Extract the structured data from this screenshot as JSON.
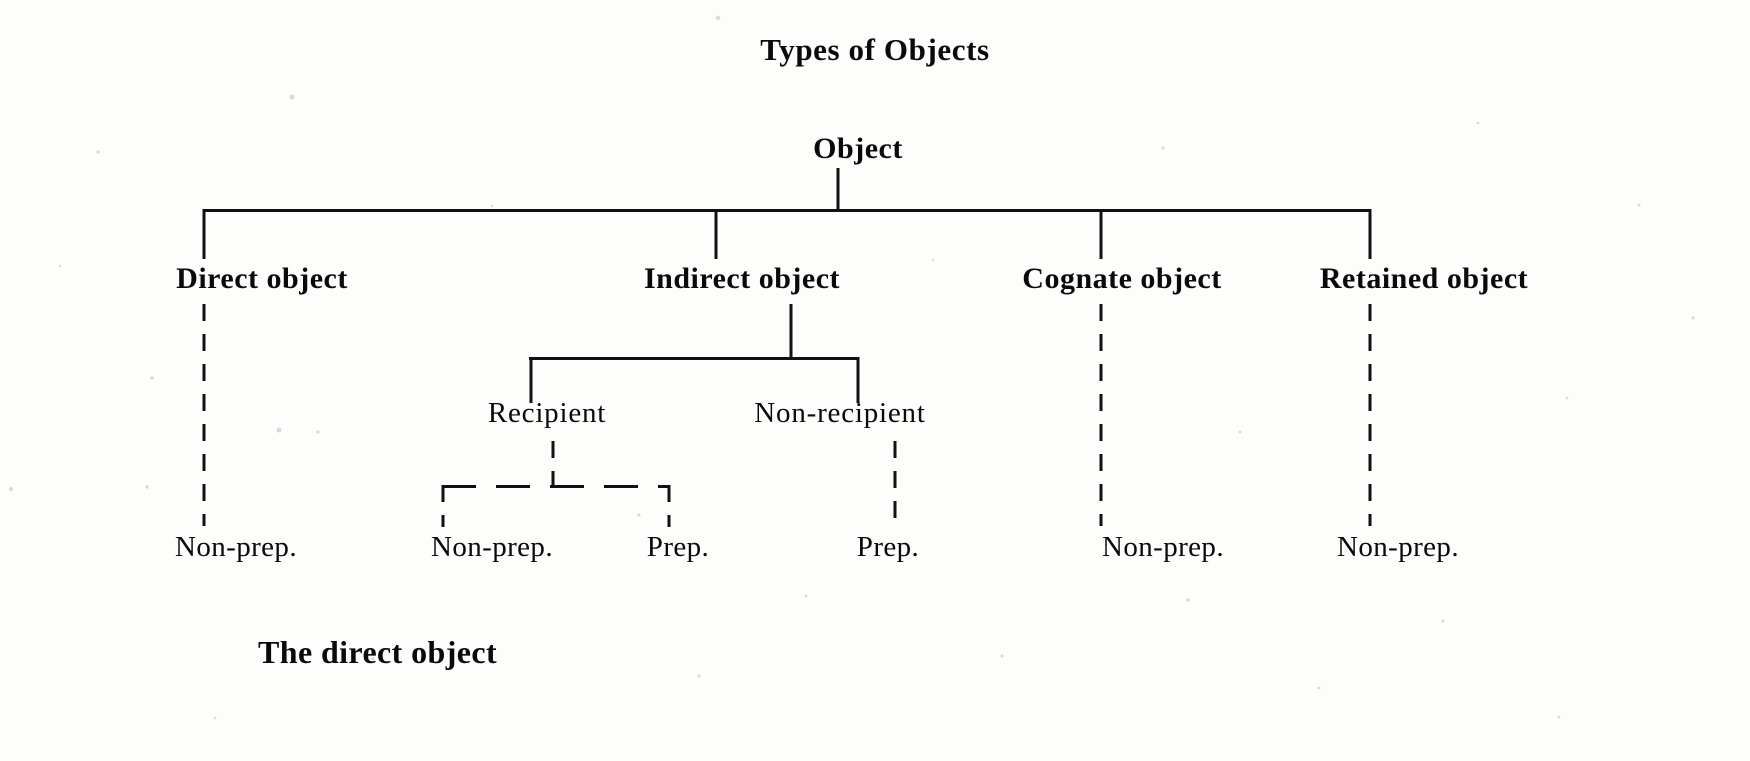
{
  "page": {
    "title": "Types of Objects",
    "caption": "The direct object",
    "ink_color": "#111111",
    "paper_color": "#fdfdfc"
  },
  "tree": {
    "root": {
      "label": "Object"
    },
    "level1": [
      {
        "label": "Direct object"
      },
      {
        "label": "Indirect object"
      },
      {
        "label": "Cognate object"
      },
      {
        "label": "Retained object"
      }
    ],
    "level2": [
      {
        "label": "Recipient"
      },
      {
        "label": "Non-recipient"
      }
    ],
    "leaves": [
      {
        "label": "Non-prep.",
        "parent": "Direct object"
      },
      {
        "label": "Non-prep.",
        "parent": "Recipient"
      },
      {
        "label": "Prep.",
        "parent": "Recipient"
      },
      {
        "label": "Prep.",
        "parent": "Non-recipient"
      },
      {
        "label": "Non-prep.",
        "parent": "Cognate object"
      },
      {
        "label": "Non-prep.",
        "parent": "Retained object"
      }
    ]
  }
}
